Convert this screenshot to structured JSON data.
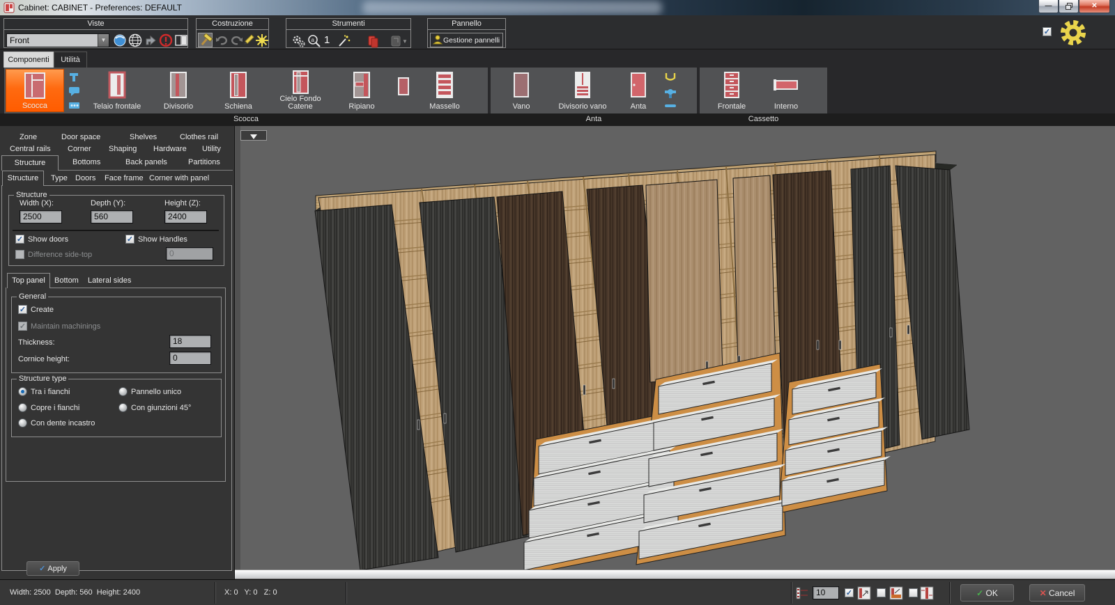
{
  "window": {
    "title": "Cabinet: CABINET - Preferences: DEFAULT"
  },
  "toolbar": {
    "groups": {
      "viste": "Viste",
      "costruzione": "Costruzione",
      "strumenti": "Strumenti",
      "pannello": "Pannello"
    },
    "view_select_value": "Front",
    "tool_number": "1",
    "gestione_pannelli": "Gestione pannelli"
  },
  "ribbon": {
    "tabs": {
      "componenti": "Componenti",
      "utilita": "Utilità"
    },
    "group_scocca": {
      "label": "Scocca",
      "items": [
        "Scocca",
        "Telaio frontale",
        "Divisorio",
        "Schiena",
        "Cielo Fondo Catene",
        "Ripiano",
        "Massello"
      ]
    },
    "group_anta": {
      "label": "Anta",
      "items": [
        "Vano",
        "Divisorio vano",
        "Anta"
      ]
    },
    "group_cassetto": {
      "label": "Cassetto",
      "items": [
        "Frontale",
        "Interno"
      ]
    },
    "selected_item": "Scocca"
  },
  "panel": {
    "tab_rows": {
      "r1": [
        "Zone",
        "Door space",
        "Shelves",
        "Clothes rail"
      ],
      "r2": [
        "Central rails",
        "Corner",
        "Shaping",
        "Hardware",
        "Utility"
      ],
      "r3": [
        "Structure",
        "Bottoms",
        "Back panels",
        "Partitions"
      ]
    },
    "subtabs": [
      "Structure",
      "Type",
      "Doors",
      "Face frame",
      "Corner with panel"
    ],
    "structure_group": {
      "label": "Structure",
      "width_label": "Width (X):",
      "width_value": "2500",
      "depth_label": "Depth (Y):",
      "depth_value": "560",
      "height_label": "Height (Z):",
      "height_value": "2400",
      "show_doors": "Show doors",
      "show_handles": "Show Handles",
      "difference_label": "Difference side-top",
      "difference_value": "0"
    },
    "panel_tabs": [
      "Top panel",
      "Bottom",
      "Lateral sides"
    ],
    "general_group": {
      "label": "General",
      "create": "Create",
      "maintain": "Maintain machinings",
      "thickness_label": "Thickness:",
      "thickness_value": "18",
      "cornice_label": "Cornice height:",
      "cornice_value": "0"
    },
    "structure_type_group": {
      "label": "Structure type",
      "options": [
        "Tra i fianchi",
        "Pannello unico",
        "Copre i fianchi",
        "Con giunzioni 45°",
        "Con dente incastro"
      ],
      "selected": "Tra i fianchi"
    },
    "apply_label": "Apply"
  },
  "statusbar": {
    "dimensions": "Width: 2500  Depth: 560  Height: 2400",
    "coords": "X: 0   Y: 0   Z: 0",
    "zoom_value": "10",
    "ok_label": "OK",
    "cancel_label": "Cancel"
  }
}
